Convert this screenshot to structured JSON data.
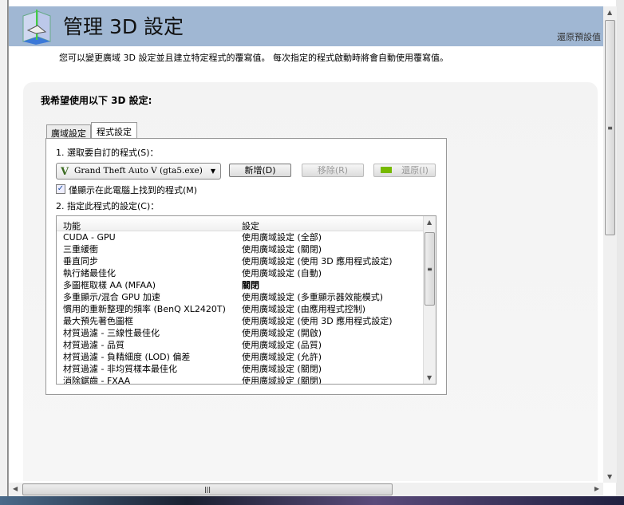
{
  "header": {
    "title": "管理 3D 設定",
    "restore_defaults": "還原預設值"
  },
  "description": "您可以變更廣域 3D 設定並且建立特定程式的覆寫值。 每次指定的程式啟動時將會自動使用覆寫值。",
  "panel": {
    "title": "我希望使用以下 3D 設定:",
    "tabs": [
      {
        "label": "廣域設定",
        "active": false
      },
      {
        "label": "程式設定",
        "active": true
      }
    ],
    "step1_label": "1. 選取要自訂的程式(S)：",
    "program_select": {
      "value": "Grand Theft Auto V (gta5.exe)",
      "icon": "gta-v-icon"
    },
    "add_button": "新增(D)",
    "remove_button": "移除(R)",
    "restore_button": "還原(I)",
    "checkbox": {
      "label": "僅顯示在此電腦上找到的程式(M)",
      "checked": true
    },
    "step2_label": "2. 指定此程式的設定(C)：",
    "columns": [
      "功能",
      "設定"
    ],
    "rows": [
      [
        "CUDA - GPU",
        "使用廣域設定 (全部)"
      ],
      [
        "三重緩衝",
        "使用廣域設定 (關閉)"
      ],
      [
        "垂直同步",
        "使用廣域設定 (使用 3D 應用程式設定)"
      ],
      [
        "執行緒最佳化",
        "使用廣域設定 (自動)"
      ],
      [
        "多圖框取樣 AA (MFAA)",
        "關閉"
      ],
      [
        "多重顯示/混合 GPU 加速",
        "使用廣域設定 (多重顯示器效能模式)"
      ],
      [
        "慣用的重新整理的頻率 (BenQ XL2420T)",
        "使用廣域設定 (由應用程式控制)"
      ],
      [
        "最大預先著色圖框",
        "使用廣域設定 (使用 3D 應用程式設定)"
      ],
      [
        "材質過濾 - 三線性最佳化",
        "使用廣域設定 (開啟)"
      ],
      [
        "材質過濾 - 品質",
        "使用廣域設定 (品質)"
      ],
      [
        "材質過濾 - 負精細度 (LOD) 偏差",
        "使用廣域設定 (允許)"
      ],
      [
        "材質過濾 - 非均質樣本最佳化",
        "使用廣域設定 (關閉)"
      ],
      [
        "消除鋸齒 - FXAA",
        "使用廣域設定 (關閉)"
      ]
    ]
  }
}
